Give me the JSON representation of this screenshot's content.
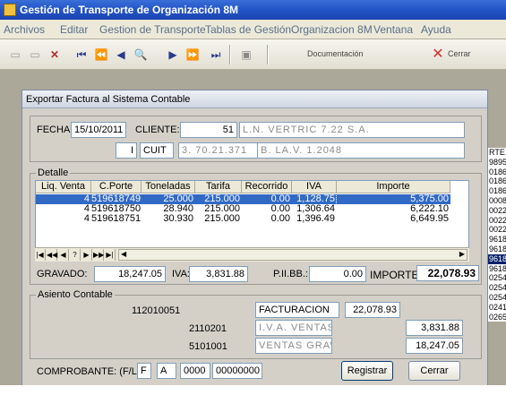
{
  "window": {
    "title": "Gestión de Transporte de Organización 8M"
  },
  "menu": [
    "Archivos",
    "Editar",
    "Gestion de Transporte",
    "Tablas de Gestión",
    "Organizacion 8M",
    "Ventana",
    "Ayuda"
  ],
  "toolbar": {
    "doc_label": "Documentación",
    "close_label": "Cerrar"
  },
  "background_list": [
    "RTE",
    "9895",
    "0186",
    "0186",
    "0186",
    "0008",
    "0022",
    "0022",
    "0022",
    "9618",
    "9618",
    "9618",
    "9618",
    "0254",
    "0254",
    "0254",
    "0241",
    "0265"
  ],
  "dialog": {
    "title": "Exportar Factura al Sistema Contable",
    "fecha_label": "FECHA:",
    "fecha": "15/10/2011",
    "cliente_label": "CLIENTE:",
    "cliente_num": "51",
    "cliente_name": "L.N. VERTRIC 7.22 S.A.",
    "iva_cond": "I",
    "cuit_label": "CUIT",
    "cuit": "3. 70.21.371",
    "address": "B. LA.V. 1.2048",
    "detalle_label": "Detalle",
    "grid": {
      "columns": [
        "Liq. Venta",
        "C.Porte",
        "Toneladas",
        "Tarifa",
        "Recorrido",
        "IVA",
        "Importe"
      ],
      "rows": [
        {
          "liq": "4",
          "porte": "519618749",
          "ton": "25.000",
          "tarifa": "215.000",
          "recorrido": "0.00",
          "iva": "1,128.75",
          "importe": "5,375.00"
        },
        {
          "liq": "4",
          "porte": "519618750",
          "ton": "28.940",
          "tarifa": "215.000",
          "recorrido": "0.00",
          "iva": "1,306.64",
          "importe": "6,222.10"
        },
        {
          "liq": "4",
          "porte": "519618751",
          "ton": "30.930",
          "tarifa": "215.000",
          "recorrido": "0.00",
          "iva": "1,396.49",
          "importe": "6,649.95"
        }
      ]
    },
    "gravado_label": "GRAVADO:",
    "gravado": "18,247.05",
    "iva_label": "IVA:",
    "iva": "3,831.88",
    "iibb_label": "P.II.BB.:",
    "iibb": "0.00",
    "importe_label": "IMPORTE:",
    "importe": "22,078.93",
    "asiento_label": "Asiento Contable",
    "asiento": {
      "cuenta1": "112010051",
      "desc1": "FACTURACION",
      "valor1": "22,078.93",
      "cuenta2": "2110201",
      "desc2": "I.V.A. VENTAS RESP.",
      "valor2": "3,831.88",
      "cuenta3": "5101001",
      "desc3": "VENTAS GRAVADAS",
      "valor3": "18,247.05"
    },
    "comprobante_label": "COMPROBANTE: (F/L)",
    "comp_tipo": "F",
    "comp_letra": "A",
    "comp_pto": "0000",
    "comp_num": "00000000",
    "registrar_label": "Registrar",
    "cerrar_label": "Cerrar"
  }
}
